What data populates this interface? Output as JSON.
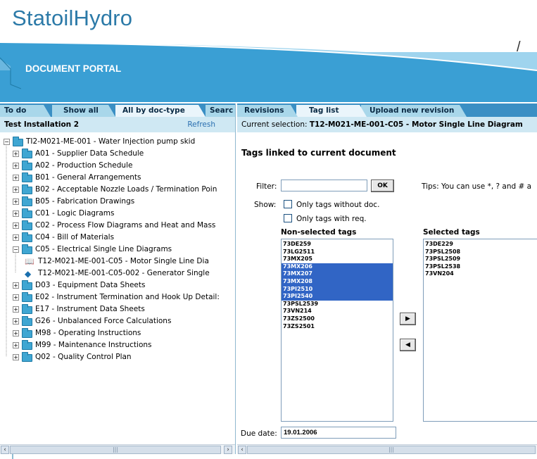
{
  "header": {
    "logo": "StatoilHydro",
    "portal_title": "DOCUMENT PORTAL",
    "slash": "/",
    "colors": {
      "band": "#3a9fd4",
      "band_light": "#9fd4ee",
      "logo": "#2c7aa8"
    }
  },
  "left": {
    "tabs": [
      "To do",
      "Show all",
      "All by doc-type",
      "Searc"
    ],
    "active_tab": "All by doc-type",
    "installation": "Test Installation 2",
    "refresh": "Refresh",
    "tree": [
      {
        "label": "TI2-M021-ME-001 - Water Injection pump skid",
        "icon": "folder-icon",
        "expand": "minus"
      },
      {
        "label": "A01 - Supplier Data Schedule",
        "icon": "folder-icon",
        "expand": "plus"
      },
      {
        "label": "A02 - Production Schedule",
        "icon": "folder-icon",
        "expand": "plus"
      },
      {
        "label": "B01 - General Arrangements",
        "icon": "folder-icon",
        "expand": "plus"
      },
      {
        "label": "B02 - Acceptable Nozzle Loads / Termination Poin",
        "icon": "folder-icon",
        "expand": "plus"
      },
      {
        "label": "B05 - Fabrication Drawings",
        "icon": "folder-icon",
        "expand": "plus"
      },
      {
        "label": "C01 - Logic Diagrams",
        "icon": "folder-icon",
        "expand": "plus"
      },
      {
        "label": "C02 - Process Flow Diagrams and Heat and Mass",
        "icon": "folder-icon",
        "expand": "plus"
      },
      {
        "label": "C04 - Bill of Materials",
        "icon": "folder-icon",
        "expand": "plus"
      },
      {
        "label": "C05 - Electrical Single Line Diagrams",
        "icon": "folder-icon",
        "expand": "minus"
      },
      {
        "label": "T12-M021-ME-001-C05 - Motor Single Line Dia",
        "icon": "open-document-icon",
        "expand": "none"
      },
      {
        "label": "T12-M021-ME-001-C05-002 - Generator Single",
        "icon": "document-icon",
        "expand": "none"
      },
      {
        "label": "D03 - Equipment Data Sheets",
        "icon": "folder-icon",
        "expand": "plus"
      },
      {
        "label": "E02 - Instrument Termination and Hook Up Detail:",
        "icon": "folder-icon",
        "expand": "plus"
      },
      {
        "label": "E17 - Instrument Data Sheets",
        "icon": "folder-icon",
        "expand": "plus"
      },
      {
        "label": "G26 - Unbalanced Force Calculations",
        "icon": "folder-icon",
        "expand": "plus"
      },
      {
        "label": "M98 - Operating Instructions",
        "icon": "folder-icon",
        "expand": "plus"
      },
      {
        "label": "M99 - Maintenance Instructions",
        "icon": "folder-icon",
        "expand": "plus"
      },
      {
        "label": "Q02 - Quality Control Plan",
        "icon": "folder-icon",
        "expand": "plus"
      }
    ],
    "scroll_thumb": "|||"
  },
  "right": {
    "tabs": [
      "Revisions",
      "Tag list",
      "Upload new revision"
    ],
    "active_tab": "Tag list",
    "selection_prefix": "Current selection: ",
    "selection_value": "T12-M021-ME-001-C05 - Motor Single Line Diagram",
    "section_title": "Tags linked to current document",
    "filter_label": "Filter:",
    "filter_value": "",
    "ok_label": "OK",
    "tips": "Tips: You can use *, ? and # a",
    "show_label": "Show:",
    "check_without_doc": "Only tags without doc.",
    "check_with_req": "Only tags with req.",
    "nonselected_title": "Non-selected tags",
    "selected_title": "Selected tags",
    "nonselected_tags": [
      {
        "tag": "73DE259",
        "highlighted": false
      },
      {
        "tag": "73LG2511",
        "highlighted": false
      },
      {
        "tag": "73MX205",
        "highlighted": false
      },
      {
        "tag": "73MX206",
        "highlighted": true
      },
      {
        "tag": "73MX207",
        "highlighted": true
      },
      {
        "tag": "73MX208",
        "highlighted": true
      },
      {
        "tag": "73PI2510",
        "highlighted": true
      },
      {
        "tag": "73PI2540",
        "highlighted": true
      },
      {
        "tag": "73PSL2539",
        "highlighted": false
      },
      {
        "tag": "73VN214",
        "highlighted": false
      },
      {
        "tag": "73ZS2500",
        "highlighted": false
      },
      {
        "tag": "73ZS2501",
        "highlighted": false
      }
    ],
    "selected_tags": [
      "73DE229",
      "73PSL2508",
      "73PSL2509",
      "73PSL2538",
      "73VN204"
    ],
    "add_icon": "▶",
    "remove_icon": "◀",
    "due_label": "Due date:",
    "due_value": "19.01.2006",
    "scroll_thumb": "|||"
  }
}
